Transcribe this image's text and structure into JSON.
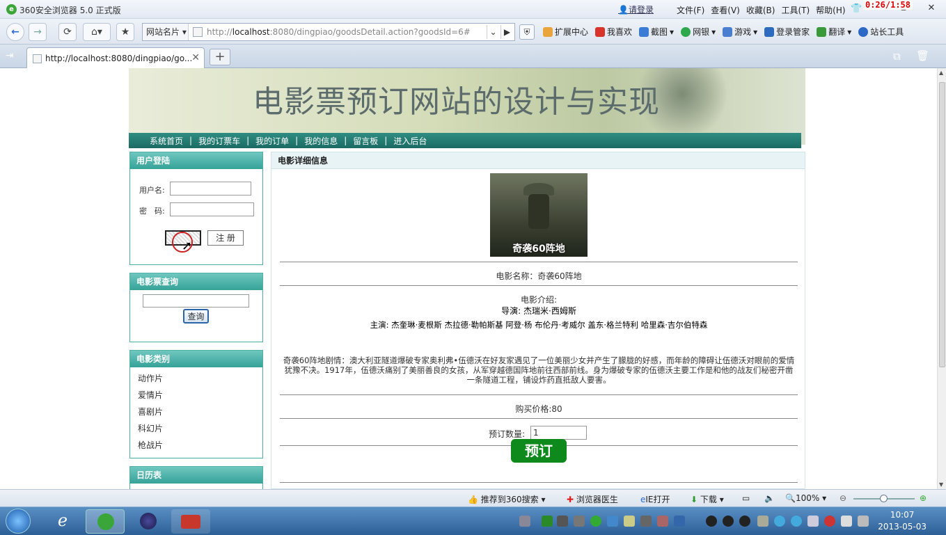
{
  "browser": {
    "title": "360安全浏览器 5.0 正式版",
    "login_link": "请登录",
    "menus": [
      "文件(F)",
      "查看(V)",
      "收藏(B)",
      "工具(T)",
      "帮助(H)"
    ],
    "timer": "0:26/1:58",
    "address": {
      "dropdown": "网站名片",
      "url_prefix": "http://",
      "url_host": "localhost",
      "url_rest": ":8080/dingpiao/goodsDetail.action?goodsId=6#"
    },
    "toolbar": [
      "扩展中心",
      "我喜欢",
      "截图",
      "网银",
      "游戏",
      "登录管家",
      "翻译",
      "站长工具"
    ],
    "tab_title": "http://localhost:8080/dingpiao/go...",
    "statusbar": {
      "recommend": "推荐到360搜索",
      "doctor": "浏览器医生",
      "ie_open": "IE打开",
      "download": "下载",
      "zoom": "100%"
    }
  },
  "site": {
    "title": "电影票预订网站的设计与实现",
    "nav": [
      "系统首页",
      "我的订票车",
      "我的订单",
      "我的信息",
      "留言板",
      "进入后台"
    ]
  },
  "sidebar": {
    "login": {
      "title": "用户登陆",
      "username_label": "用户名:",
      "password_label": "密　码:",
      "register_label": "注 册"
    },
    "search": {
      "title": "电影票查询",
      "button": "查询"
    },
    "categories": {
      "title": "电影类别",
      "items": [
        "动作片",
        "爱情片",
        "喜剧片",
        "科幻片",
        "枪战片"
      ]
    },
    "calendar": {
      "title": "日历表"
    }
  },
  "detail": {
    "header": "电影详细信息",
    "poster_caption": "奇袭60阵地",
    "name_line": "电影名称：奇袭60阵地",
    "intro_label": "电影介绍:",
    "director_line": "导演:  杰瑞米·西姆斯",
    "cast_line": "主演:  杰奎琳·麦根斯 杰拉德·勒帕斯基 阿登·杨 布伦丹·考威尔 盖东·格兰特利 哈里森·吉尔伯特森",
    "synopsis": "奇袭60阵地剧情：澳大利亚隧道爆破专家奥利弗•伍德沃在好友家遇见了一位美丽少女并产生了朦胧的好感，而年龄的障碍让伍德沃对眼前的爱情犹豫不决。1917年，伍德沃痛别了美丽善良的女孩，从军穿越德国阵地前往西部前线。身为爆破专家的伍德沃主要工作是和他的战友们秘密开凿一条隧道工程，铺设炸药直抵敌人要害。",
    "price_line": "购买价格:80",
    "quantity_label": "预订数量:",
    "quantity_value": "1",
    "order_button": "预订"
  },
  "taskbar": {
    "time": "10:07",
    "date": "2013-05-03"
  }
}
